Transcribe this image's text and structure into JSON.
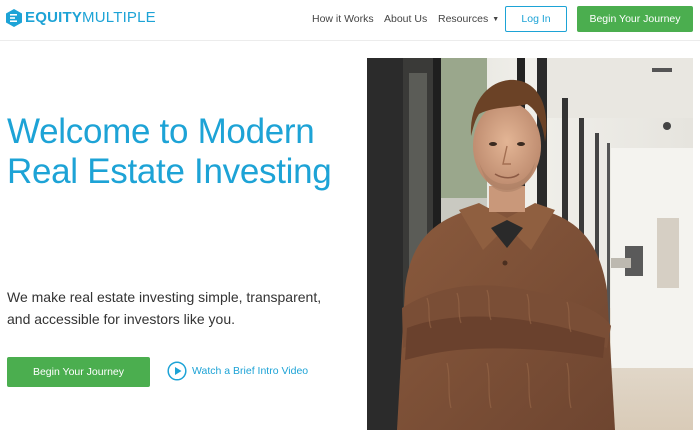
{
  "brand": {
    "name_bold": "EQUITY",
    "name_light": "MULTIPLE",
    "accent_color": "#1da3d6",
    "cta_color": "#4bae4f"
  },
  "nav": {
    "how_it_works": "How it Works",
    "about_us": "About Us",
    "resources": "Resources",
    "login": "Log In",
    "begin_journey": "Begin Your Journey"
  },
  "hero": {
    "headline": "Welcome to Modern Real Estate Investing",
    "subtext": "We make real estate investing simple, transparent, and accessible for investors like you.",
    "cta_label": "Begin Your Journey",
    "video_label": "Watch a Brief Intro Video",
    "photo_subject": "man-in-brown-sweater-photo"
  }
}
